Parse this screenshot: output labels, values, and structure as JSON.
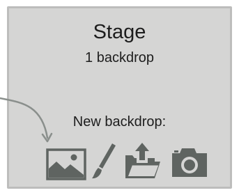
{
  "stage": {
    "title": "Stage",
    "backdrop_count": "1 backdrop"
  },
  "new_backdrop": {
    "label": "New backdrop:",
    "icons": [
      "image-library-icon",
      "paint-brush-icon",
      "upload-icon",
      "camera-icon"
    ]
  },
  "colors": {
    "panel_bg": "#d5d5d4",
    "panel_border": "#bdbdbc",
    "icon": "#5f6461",
    "arrow": "#8a8f8c",
    "text": "#1d1d1d"
  }
}
